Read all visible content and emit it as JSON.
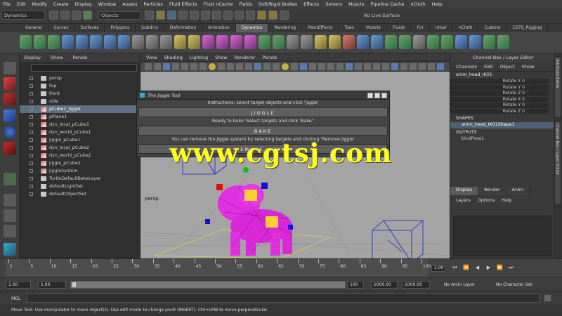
{
  "menubar": [
    "File",
    "Edit",
    "Modify",
    "Create",
    "Display",
    "Window",
    "Assets",
    "Particles",
    "Fluid Effects",
    "Fluid nCache",
    "Fields",
    "Soft/Rigid Bodies",
    "Effects",
    "Solvers",
    "Muscle",
    "Pipeline Cache",
    "nCloth",
    "Help"
  ],
  "statusline": {
    "mode": "Dynamics",
    "objects_label": "Objects",
    "live_label": "No Live Surface"
  },
  "shelf_tabs": [
    "General",
    "Curves",
    "Surfaces",
    "Polygons",
    "Subdivs",
    "Deformation",
    "Animation",
    "Dynamics",
    "Rendering",
    "PaintEffects",
    "Toon",
    "Muscle",
    "Fluids",
    "Fur",
    "nHair",
    "nCloth",
    "Custom",
    "CGTS_Rigging"
  ],
  "shelf_active": "Dynamics",
  "outliner": {
    "menu": [
      "Display",
      "Show",
      "Panels"
    ],
    "items": [
      {
        "label": "persp",
        "icon": "camera-icon",
        "selected": false
      },
      {
        "label": "top",
        "icon": "camera-icon",
        "selected": false
      },
      {
        "label": "front",
        "icon": "camera-icon",
        "selected": false
      },
      {
        "label": "side",
        "icon": "camera-icon",
        "selected": false
      },
      {
        "label": "pCube1_Jiggle",
        "icon": "mesh-icon",
        "selected": true
      },
      {
        "label": "pPlane1",
        "icon": "mesh-icon",
        "selected": false
      },
      {
        "label": "dyn_local_pCube1",
        "icon": "mesh-icon",
        "selected": false
      },
      {
        "label": "dyn_world_pCube1",
        "icon": "mesh-icon",
        "selected": false
      },
      {
        "label": "jiggle_pCube1",
        "icon": "mesh-icon",
        "selected": false
      },
      {
        "label": "dyn_local_pCube2",
        "icon": "mesh-icon",
        "selected": false
      },
      {
        "label": "dyn_world_pCube2",
        "icon": "mesh-icon",
        "selected": false
      },
      {
        "label": "jiggle_pCube2",
        "icon": "mesh-icon",
        "selected": false
      },
      {
        "label": "jiggleSystem",
        "icon": "mesh-icon",
        "selected": false
      },
      {
        "label": "TurtleDefaultBakeLayer",
        "icon": "layer-icon",
        "selected": false
      },
      {
        "label": "defaultLightSet",
        "icon": "set-icon",
        "selected": false
      },
      {
        "label": "defaultObjectSet",
        "icon": "set-icon",
        "selected": false
      }
    ]
  },
  "panel": {
    "menu": [
      "View",
      "Shading",
      "Lighting",
      "Show",
      "Renderer",
      "Panels"
    ],
    "camera_label": "persp"
  },
  "jiggle_tool": {
    "title": "The Jiggle Tool",
    "instructions": "Instructions: select target objects and click 'Jiggle'",
    "jiggle_button": "JIGGLE",
    "bake_hint": "Ready to bake 'Select targets and click 'Bake''",
    "bake_button": "BAKE",
    "remove_hint": "You can remove the jiggle system by selecting targets and clicking 'Remove Jiggle'",
    "remove_button": "REMOVE JIGGLE"
  },
  "channel_box": {
    "header": "Channel Box / Layer Editor",
    "menu": [
      "Channels",
      "Edit",
      "Object",
      "Show"
    ],
    "object_name": "anim_head_IK01",
    "rows": [
      {
        "label": "Rotate X 0"
      },
      {
        "label": "Rotate Y 0"
      },
      {
        "label": "Rotate Z 0"
      },
      {
        "label": "Rotate X 0"
      },
      {
        "label": "Rotate Y 0"
      },
      {
        "label": "Rotate Z 0"
      }
    ],
    "shapes_label": "SHAPES",
    "shape_item": "anim_head_IK01Shape1",
    "outputs_label": "OUTPUTS",
    "output_item": "bindPose1",
    "layer_tabs": [
      "Display",
      "Render",
      "Anim"
    ],
    "layer_menu": [
      "Layers",
      "Options",
      "Help"
    ],
    "side_tabs": [
      "Attribute Editor",
      "Channel Box / Layer Editor"
    ]
  },
  "timeline": {
    "ticks": [
      "1",
      "5",
      "10",
      "15",
      "20",
      "25",
      "30",
      "35",
      "40",
      "45",
      "50",
      "55",
      "60",
      "65",
      "70",
      "75",
      "80",
      "85",
      "90",
      "95",
      "100"
    ],
    "current_frame": "1.00",
    "play_buttons": [
      "⏮",
      "⏪",
      "◀",
      "▶",
      "⏩",
      "⏭"
    ]
  },
  "range": {
    "start": "1.00",
    "start2": "1.00",
    "end": "100",
    "end2": "1000.00",
    "end3": "1000.00",
    "anim_layer": "No Anim Layer",
    "char_set": "No Character Set"
  },
  "command_line": {
    "label": "MEL"
  },
  "help_line": "Move Tool: Use manipulator to move object(s). Use edit mode to change pivot (INSERT). Ctrl+LMB to move perpendicular.",
  "watermark": "www.cgtsj.com",
  "colors": {
    "viewport_bg": "#a4a4a4",
    "selection": "#5f6f84",
    "mesh_magenta": "#e020e0",
    "watermark": "#ffff1a"
  }
}
